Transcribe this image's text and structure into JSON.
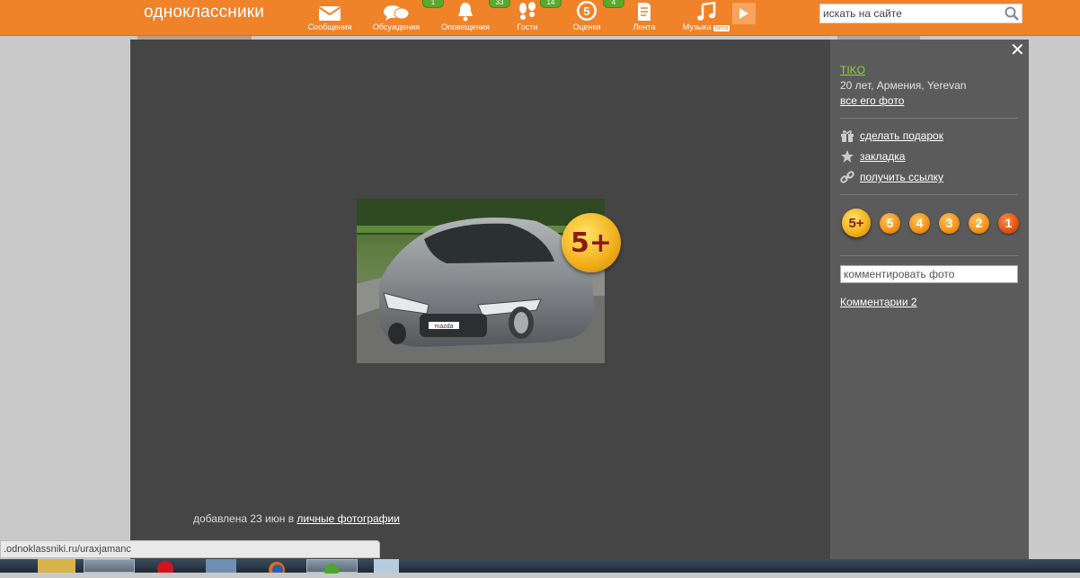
{
  "header": {
    "logo": "одноклассники",
    "nav": [
      {
        "label": "Сообщения",
        "icon": "envelope-icon",
        "badge": ""
      },
      {
        "label": "Обсуждения",
        "icon": "chat-bubbles-icon",
        "badge": "1"
      },
      {
        "label": "Оповещения",
        "icon": "bell-icon",
        "badge": "33"
      },
      {
        "label": "Гости",
        "icon": "footprints-icon",
        "badge": "14"
      },
      {
        "label": "Оценки",
        "icon": "grade-5-icon",
        "badge": "4"
      },
      {
        "label": "Лента",
        "icon": "feed-icon",
        "badge": ""
      },
      {
        "label": "Музыка",
        "icon": "music-note-icon",
        "badge": "",
        "tag": "бета"
      }
    ],
    "search_placeholder": "искать на сайте"
  },
  "viewer": {
    "photo_alt": "mazda",
    "grade_badge": "5+",
    "caption_prefix": "добавлена 23 июн в",
    "caption_album": "личные фотографии"
  },
  "side": {
    "user_name": "TIKO ",
    "user_info": "20 лет, Армения, Yerevan",
    "all_photos": "все его фото",
    "actions": [
      {
        "label": "сделать подарок",
        "icon": "gift-icon"
      },
      {
        "label": "закладка",
        "icon": "star-icon"
      },
      {
        "label": "получить ссылку",
        "icon": "link-icon"
      }
    ],
    "ratings": [
      "5+",
      "5",
      "4",
      "3",
      "2",
      "1"
    ],
    "comment_placeholder": "комментировать фото",
    "comments_link": "Комментарии 2"
  },
  "statusbar": {
    "url": ".odnoklassniki.ru/uraxjamanc"
  },
  "colors": {
    "brand": "#f0822a",
    "viewer_bg": "#454545",
    "panel_bg": "#5b5b5b",
    "user_link": "#8fd33b"
  }
}
